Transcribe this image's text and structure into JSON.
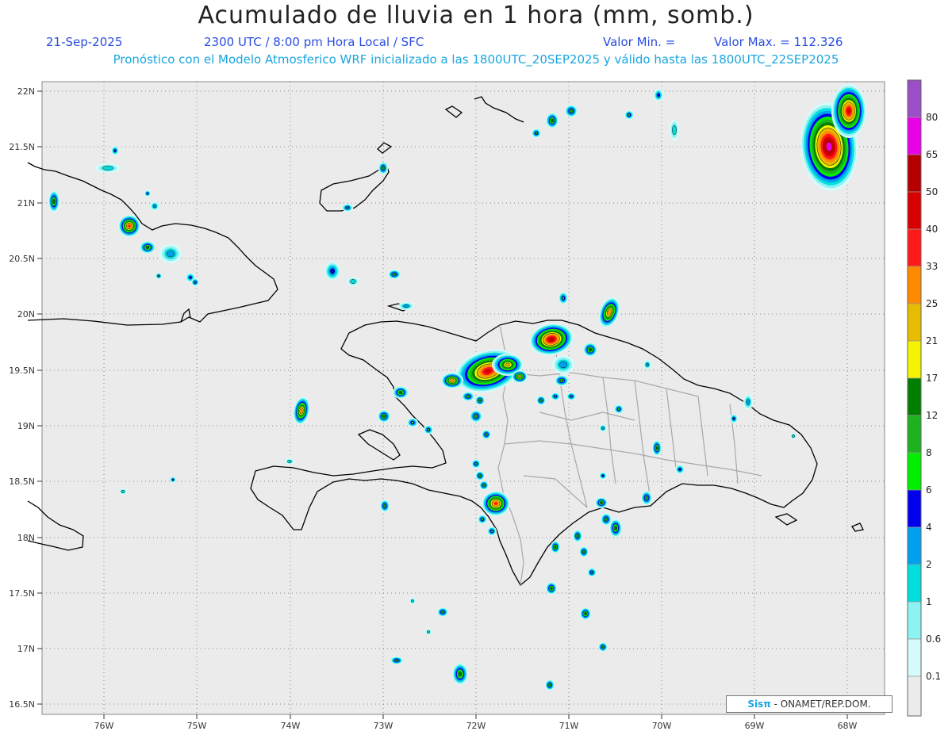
{
  "header": {
    "title": "Acumulado de lluvia en 1 hora (mm, somb.)",
    "date": "21-Sep-2025",
    "time": "2300 UTC / 8:00 pm Hora Local / SFC",
    "min_label": "Valor Min. =",
    "max_label": "Valor Max. = 112.326",
    "model_info": "Pronóstico con el Modelo Atmosferico WRF inicializado a las 1800UTC_20SEP2025 y válido hasta las  1800UTC_22SEP2025"
  },
  "map": {
    "lat_labels": [
      "22N",
      "21.5N",
      "21N",
      "20.5N",
      "20N",
      "19.5N",
      "19N",
      "18.5N",
      "18N",
      "17.5N",
      "17N",
      "16.5N"
    ],
    "lon_labels": [
      "76W",
      "75W",
      "74W",
      "73W",
      "72W",
      "71W",
      "70W",
      "69W",
      "68W"
    ],
    "ocean_color": "#ebebeb",
    "coast_color": "#000000",
    "border_color": "#a8a8a8"
  },
  "legend": {
    "labels": [
      "80",
      "65",
      "50",
      "40",
      "33",
      "25",
      "21",
      "17",
      "12",
      "8",
      "6",
      "4",
      "2",
      "1",
      "0.6",
      "0.1"
    ],
    "colors": [
      "#9b4fc7",
      "#e800e8",
      "#b40000",
      "#d80000",
      "#ff1a1a",
      "#ff8a00",
      "#e8bc00",
      "#f4f400",
      "#007f00",
      "#1fb21f",
      "#00f000",
      "#0000ee",
      "#00a0f0",
      "#00dede",
      "#8cf2f2",
      "#d6fbfb",
      "#ebebeb"
    ]
  },
  "credit": {
    "logo": "Sisπ",
    "text": " - ONAMET/REP.DOM."
  }
}
